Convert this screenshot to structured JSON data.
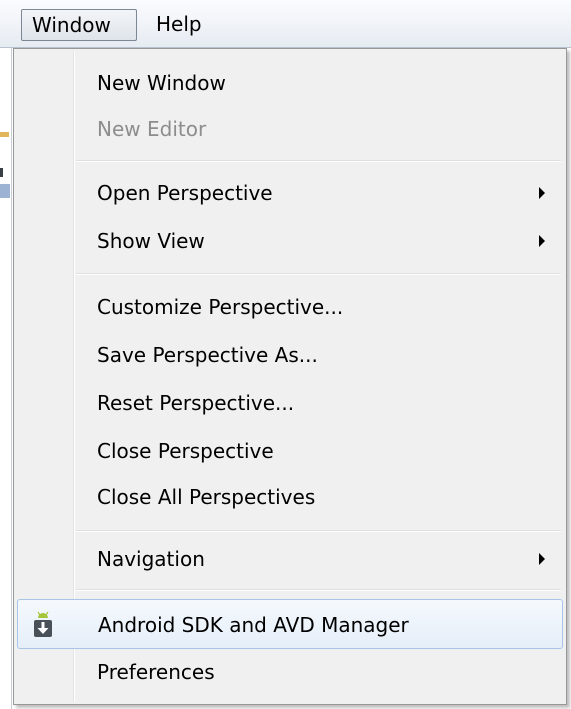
{
  "menubar": {
    "items": [
      {
        "label": "Window",
        "active": true
      },
      {
        "label": "Help",
        "active": false
      }
    ]
  },
  "menu": {
    "items": [
      {
        "label": "New Window",
        "enabled": true,
        "submenu": false
      },
      {
        "label": "New Editor",
        "enabled": false,
        "submenu": false
      },
      {
        "label": "Open Perspective",
        "enabled": true,
        "submenu": true
      },
      {
        "label": "Show View",
        "enabled": true,
        "submenu": true
      },
      {
        "label": "Customize Perspective...",
        "enabled": true,
        "submenu": false
      },
      {
        "label": "Save Perspective As...",
        "enabled": true,
        "submenu": false
      },
      {
        "label": "Reset Perspective...",
        "enabled": true,
        "submenu": false
      },
      {
        "label": "Close Perspective",
        "enabled": true,
        "submenu": false
      },
      {
        "label": "Close All Perspectives",
        "enabled": true,
        "submenu": false
      },
      {
        "label": "Navigation",
        "enabled": true,
        "submenu": true
      },
      {
        "label": "Android SDK and AVD Manager",
        "enabled": true,
        "submenu": false,
        "highlighted": true,
        "icon": "android-sdk-icon"
      },
      {
        "label": "Preferences",
        "enabled": true,
        "submenu": false
      }
    ]
  },
  "colors": {
    "highlight_border": "#a8c4e6",
    "disabled_text": "#8d8d8d",
    "android_green": "#a4c639"
  }
}
